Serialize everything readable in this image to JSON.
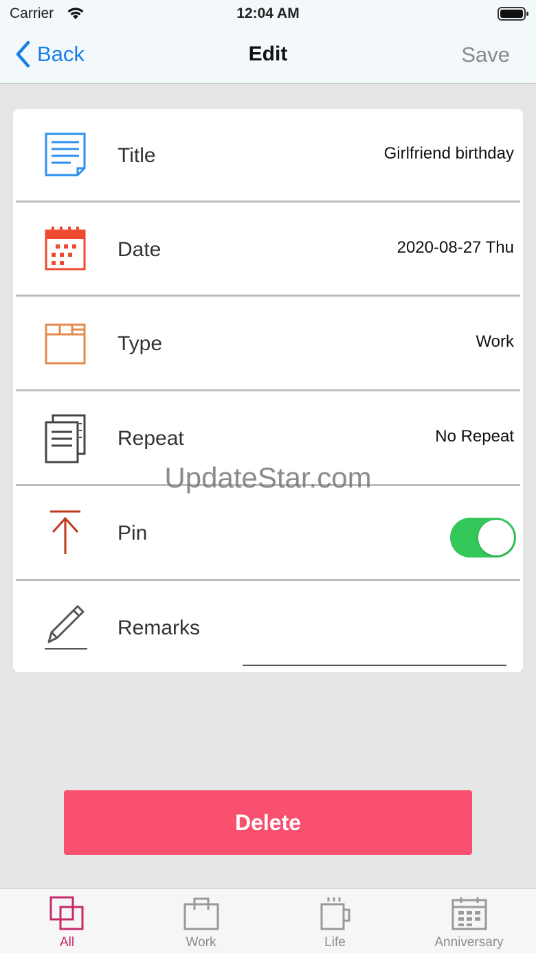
{
  "status_bar": {
    "carrier": "Carrier",
    "time": "12:04 AM"
  },
  "nav": {
    "back_label": "Back",
    "title": "Edit",
    "save_label": "Save"
  },
  "form": {
    "rows": [
      {
        "label": "Title",
        "value": "Girlfriend birthday",
        "icon": "note-icon"
      },
      {
        "label": "Date",
        "value": "2020-08-27 Thu",
        "icon": "calendar-icon"
      },
      {
        "label": "Type",
        "value": "Work",
        "icon": "folder-icon"
      },
      {
        "label": "Repeat",
        "value": "No Repeat",
        "icon": "copy-pages-icon"
      },
      {
        "label": "Pin",
        "icon": "pin-arrow-icon",
        "toggle_on": true
      },
      {
        "label": "Remarks",
        "value": "",
        "icon": "pencil-icon"
      }
    ]
  },
  "watermark": "UpdateStar.com",
  "delete_label": "Delete",
  "tabs": [
    {
      "label": "All",
      "icon": "overlap-squares-icon",
      "active": true
    },
    {
      "label": "Work",
      "icon": "briefcase-icon",
      "active": false
    },
    {
      "label": "Life",
      "icon": "coffee-cup-icon",
      "active": false
    },
    {
      "label": "Anniversary",
      "icon": "calendar-icon",
      "active": false
    }
  ],
  "colors": {
    "accent_blue": "#1a7fe8",
    "toggle_green": "#34c759",
    "delete_red": "#fa506f",
    "tab_active": "#c5296a"
  }
}
